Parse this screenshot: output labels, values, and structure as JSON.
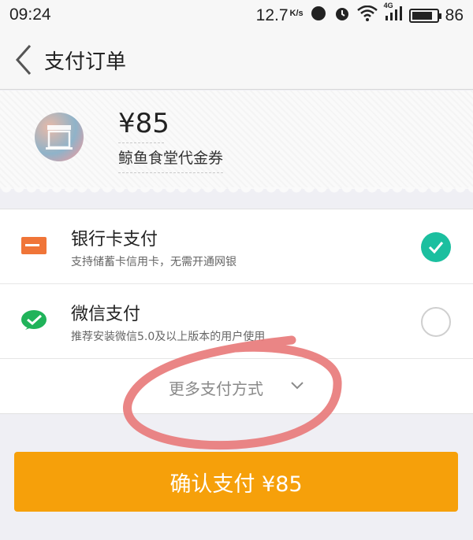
{
  "status_bar": {
    "time": "09:24",
    "speed": "12.7",
    "speed_unit": "K/s",
    "battery": "86",
    "battery_level": 0.86,
    "network": "4G"
  },
  "nav": {
    "title": "支付订单"
  },
  "order": {
    "price": "¥85",
    "product_name": "鲸鱼食堂代金券"
  },
  "payment_methods": [
    {
      "title": "银行卡支付",
      "desc": "支持储蓄卡信用卡，无需开通网银",
      "selected": true,
      "icon": "bank-card-icon"
    },
    {
      "title": "微信支付",
      "desc": "推荐安装微信5.0及以上版本的用户使用",
      "selected": false,
      "icon": "wechat-pay-icon"
    }
  ],
  "more": {
    "label": "更多支付方式"
  },
  "confirm": {
    "label": "确认支付 ¥85"
  },
  "colors": {
    "accent_orange": "#f6a00a",
    "check_green": "#1bbf9f",
    "annotation_red": "#e87b7b"
  }
}
